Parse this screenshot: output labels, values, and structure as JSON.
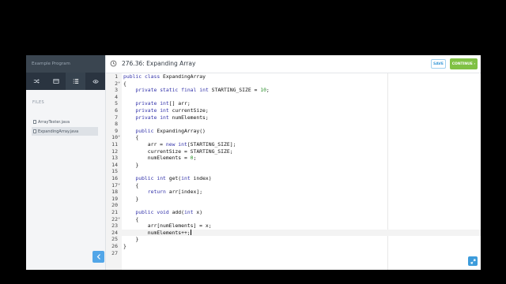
{
  "sidebar": {
    "program_title": "Example Program",
    "tabs": [
      {
        "icon": "shuffle-icon"
      },
      {
        "icon": "window-icon"
      },
      {
        "icon": "list-icon",
        "active": true
      },
      {
        "icon": "eye-icon"
      }
    ],
    "files_label": "FILES",
    "files": [
      {
        "name": "ArrayTester.java",
        "active": false
      },
      {
        "name": "ExpandingArray.java",
        "active": true
      }
    ],
    "collapse_icon": "chevron-left-icon"
  },
  "header": {
    "icon": "history-icon",
    "title": "276.36: Expanding Array",
    "save_label": "SAVE",
    "continue_label": "CONTINUE ›"
  },
  "editor": {
    "current_line": 24,
    "lines": [
      {
        "n": "1",
        "fold": false,
        "code": "public class ExpandingArray"
      },
      {
        "n": "2",
        "fold": true,
        "code": "{"
      },
      {
        "n": "3",
        "fold": false,
        "code": "    private static final int STARTING_SIZE = 10;"
      },
      {
        "n": "4",
        "fold": false,
        "code": ""
      },
      {
        "n": "5",
        "fold": false,
        "code": "    private int[] arr;"
      },
      {
        "n": "6",
        "fold": false,
        "code": "    private int currentSize;"
      },
      {
        "n": "7",
        "fold": false,
        "code": "    private int numElements;"
      },
      {
        "n": "8",
        "fold": false,
        "code": ""
      },
      {
        "n": "9",
        "fold": false,
        "code": "    public ExpandingArray()"
      },
      {
        "n": "10",
        "fold": true,
        "code": "    {"
      },
      {
        "n": "11",
        "fold": false,
        "code": "        arr = new int[STARTING_SIZE];"
      },
      {
        "n": "12",
        "fold": false,
        "code": "        currentSize = STARTING_SIZE;"
      },
      {
        "n": "13",
        "fold": false,
        "code": "        numElements = 0;"
      },
      {
        "n": "14",
        "fold": false,
        "code": "    }"
      },
      {
        "n": "15",
        "fold": false,
        "code": ""
      },
      {
        "n": "16",
        "fold": false,
        "code": "    public int get(int index)"
      },
      {
        "n": "17",
        "fold": true,
        "code": "    {"
      },
      {
        "n": "18",
        "fold": false,
        "code": "        return arr[index];"
      },
      {
        "n": "19",
        "fold": false,
        "code": "    }"
      },
      {
        "n": "20",
        "fold": false,
        "code": ""
      },
      {
        "n": "21",
        "fold": false,
        "code": "    public void add(int x)"
      },
      {
        "n": "22",
        "fold": true,
        "code": "    {"
      },
      {
        "n": "23",
        "fold": false,
        "code": "        arr[numElements] = x;"
      },
      {
        "n": "24",
        "fold": false,
        "code": "        numElements++;"
      },
      {
        "n": "25",
        "fold": false,
        "code": "    }"
      },
      {
        "n": "26",
        "fold": false,
        "code": "}"
      },
      {
        "n": "27",
        "fold": false,
        "code": ""
      }
    ],
    "expand_icon": "expand-icon"
  },
  "colors": {
    "continue": "#80c144",
    "save_border": "#9fd0ef",
    "accent_blue": "#3d9cdb",
    "sidebar_dark": "#2a3440"
  }
}
